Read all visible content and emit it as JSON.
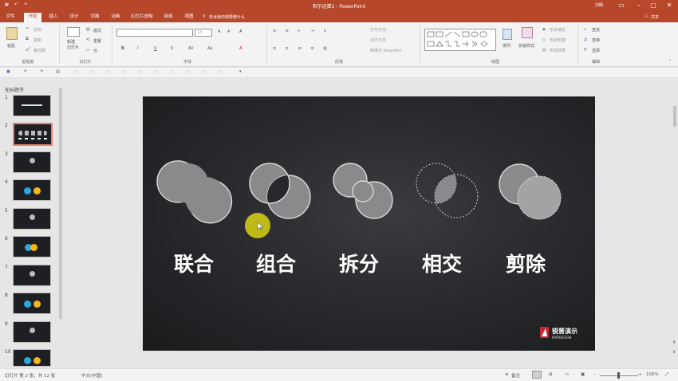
{
  "window": {
    "title": "布尔运算2 - PowerPoint",
    "user": "刘明"
  },
  "tabs": [
    "文件",
    "开始",
    "插入",
    "设计",
    "切换",
    "动画",
    "幻灯片放映",
    "审阅",
    "视图"
  ],
  "tell_me": "告诉我你想要做什么",
  "share": "共享",
  "ribbon": {
    "clipboard": {
      "label": "剪贴板",
      "paste": "粘贴",
      "cut": "剪切",
      "copy": "复制",
      "painter": "格式刷"
    },
    "slides": {
      "label": "幻灯片",
      "new_slide": "新建\n幻灯片",
      "layout": "版式",
      "reset": "重置",
      "section": "节"
    },
    "font": {
      "label": "字体",
      "size": "18",
      "bold": "B",
      "italic": "I",
      "underline": "U",
      "strike": "S"
    },
    "paragraph": {
      "label": "段落",
      "text_dir": "文字方向",
      "align_text": "对齐文本",
      "smartart": "转换为 SmartArt"
    },
    "drawing": {
      "label": "绘图",
      "arrange": "排列",
      "quick_styles": "快速样式",
      "fill": "形状填充",
      "outline": "形状轮廓",
      "effects": "形状效果"
    },
    "editing": {
      "label": "编辑",
      "find": "查找",
      "replace": "替换",
      "select": "选择"
    }
  },
  "thumbnails": {
    "section": "无标题节",
    "numbers": [
      "1",
      "2",
      "3",
      "4",
      "5",
      "6",
      "7",
      "8",
      "9",
      "10"
    ],
    "selected": 2
  },
  "slide": {
    "words": [
      "联合",
      "组合",
      "拆分",
      "相交",
      "剪除"
    ],
    "logo_text": "锐普演示",
    "logo_sub": "RAPIDESIGN"
  },
  "status": {
    "slide_info": "幻灯片 第 2 张，共 12 张",
    "language": "中文(中国)",
    "notes": "备注",
    "zoom": "100%"
  },
  "colors": {
    "accent": "#b7472a",
    "slide_bg": "#27282b",
    "cursor_highlight": "#c8c218",
    "thumb_blue": "#29a9e0",
    "thumb_yellow": "#f2b51c"
  }
}
